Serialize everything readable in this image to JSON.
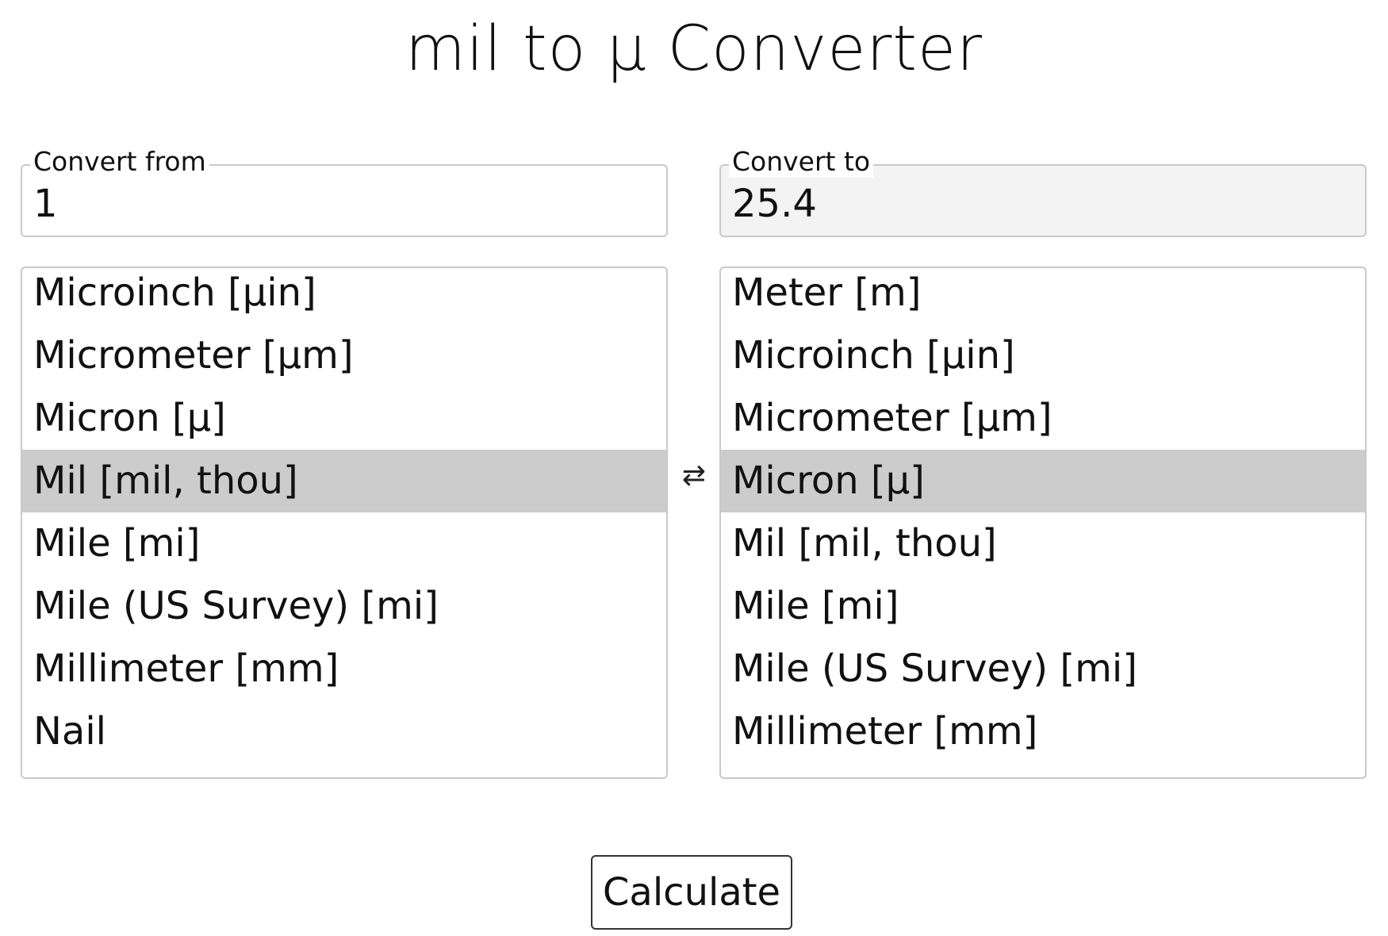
{
  "title": "mil to µ Converter",
  "from": {
    "legend": "Convert from",
    "value": "1",
    "units": [
      "Microinch [µin]",
      "Micrometer [µm]",
      "Micron [µ]",
      "Mil [mil, thou]",
      "Mile [mi]",
      "Mile (US Survey) [mi]",
      "Millimeter [mm]",
      "Nail"
    ],
    "selected_unit": "Mil [mil, thou]"
  },
  "to": {
    "legend": "Convert to",
    "value": "25.4",
    "units": [
      "Meter [m]",
      "Microinch [µin]",
      "Micrometer [µm]",
      "Micron [µ]",
      "Mil [mil, thou]",
      "Mile [mi]",
      "Mile (US Survey) [mi]",
      "Millimeter [mm]"
    ],
    "selected_unit": "Micron [µ]"
  },
  "swap_glyph": "⇄",
  "calculate_label": "Calculate",
  "colors": {
    "selected_row": "#cccccc",
    "output_field_bg": "#f3f3f3",
    "border": "#c9c9c9"
  }
}
